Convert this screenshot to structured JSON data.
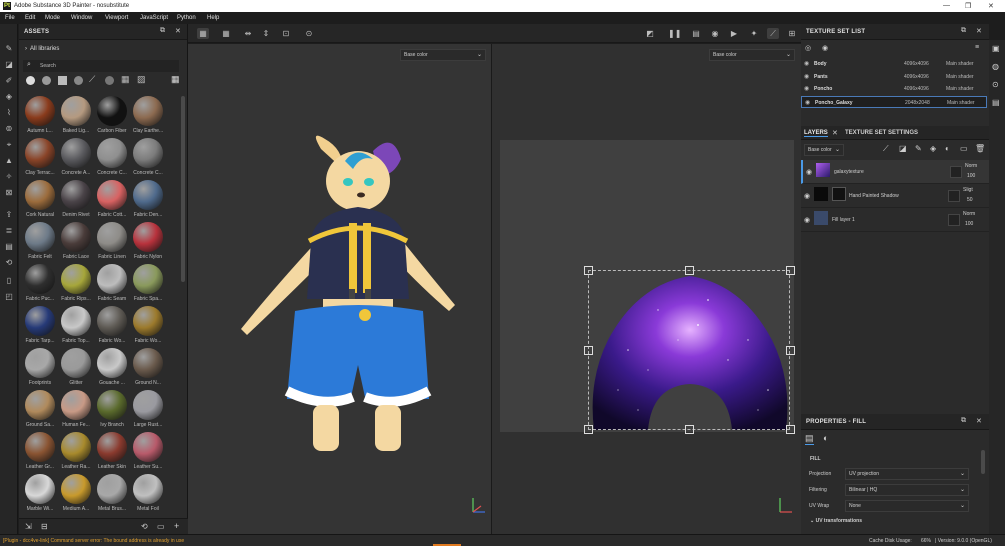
{
  "window": {
    "title": "Adobe Substance 3D Painter - nosubstitute",
    "minimize": "—",
    "restore": "❐",
    "close": "✕"
  },
  "menu": [
    "File",
    "Edit",
    "Mode",
    "Window",
    "Viewport",
    "JavaScript",
    "Python",
    "Help"
  ],
  "assets": {
    "title": "ASSETS",
    "all_libraries": "All libraries",
    "search_placeholder": "Search",
    "items": [
      {
        "label": "Autumn L...",
        "color": "#8a3b1c"
      },
      {
        "label": "Baked Lig...",
        "color": "#b59a80"
      },
      {
        "label": "Carbon Fiber",
        "color": "#111111"
      },
      {
        "label": "Clay Earthe...",
        "color": "#8c6a50"
      },
      {
        "label": "Clay Terrac...",
        "color": "#8a4428"
      },
      {
        "label": "Concrete A...",
        "color": "#5a5a5e"
      },
      {
        "label": "Concrete C...",
        "color": "#8f8f8f"
      },
      {
        "label": "Concrete C...",
        "color": "#7c7c7c"
      },
      {
        "label": "Cork Natural",
        "color": "#9c6c3c"
      },
      {
        "label": "Denim Rivet",
        "color": "#4a4348"
      },
      {
        "label": "Fabric Cott...",
        "color": "#d86262"
      },
      {
        "label": "Fabric Den...",
        "color": "#4f6a8c"
      },
      {
        "label": "Fabric Felt",
        "color": "#6d7a88"
      },
      {
        "label": "Fabric Lace",
        "color": "#4a3c3a"
      },
      {
        "label": "Fabric Linen",
        "color": "#8e8c88"
      },
      {
        "label": "Fabric Nylon",
        "color": "#b8323c"
      },
      {
        "label": "Fabric Puc...",
        "color": "#2e2e2e"
      },
      {
        "label": "Fabric Rips...",
        "color": "#a6a63a"
      },
      {
        "label": "Fabric Seam",
        "color": "#bdbdbd"
      },
      {
        "label": "Fabric Spa...",
        "color": "#8a9a5c"
      },
      {
        "label": "Fabric Tarp...",
        "color": "#263a78"
      },
      {
        "label": "Fabric Top...",
        "color": "#c8c8c8"
      },
      {
        "label": "Fabric Wo...",
        "color": "#5e5a54"
      },
      {
        "label": "Fabric Wo...",
        "color": "#9c7a2c"
      },
      {
        "label": "Footprints",
        "color": "#a8a8a8"
      },
      {
        "label": "Glitter",
        "color": "#9a9a9a"
      },
      {
        "label": "Gouache ...",
        "color": "#c9c9c9"
      },
      {
        "label": "Ground N...",
        "color": "#6a5a4c"
      },
      {
        "label": "Ground Sa...",
        "color": "#b08a5c"
      },
      {
        "label": "Human Fe...",
        "color": "#c89a86"
      },
      {
        "label": "Ivy Branch",
        "color": "#5a6a2c"
      },
      {
        "label": "Large Rust...",
        "color": "#9a9aa0"
      },
      {
        "label": "Leather Gr...",
        "color": "#8a5432"
      },
      {
        "label": "Leather Ra...",
        "color": "#a88a2c"
      },
      {
        "label": "Leather Skin",
        "color": "#8a3a2e"
      },
      {
        "label": "Leather Su...",
        "color": "#b85a6a"
      },
      {
        "label": "Marble Wi...",
        "color": "#d8d8d8"
      },
      {
        "label": "Medium A...",
        "color": "#c89a2c"
      },
      {
        "label": "Metal Brus...",
        "color": "#a8a8a8"
      },
      {
        "label": "Metal Foil",
        "color": "#c0c0c0"
      }
    ]
  },
  "viewport3d": {
    "channel": "Base color"
  },
  "viewport2d": {
    "channel": "Base color"
  },
  "texture_set_list": {
    "title": "TEXTURE SET LIST",
    "rows": [
      {
        "name": "Body",
        "res": "4096x4096",
        "shader": "Main shader"
      },
      {
        "name": "Pants",
        "res": "4096x4096",
        "shader": "Main shader"
      },
      {
        "name": "Poncho",
        "res": "4096x4096",
        "shader": "Main shader"
      },
      {
        "name": "Poncho_Galaxy",
        "res": "2048x2048",
        "shader": "Main shader"
      }
    ]
  },
  "layers": {
    "tab_layers": "LAYERS",
    "tab_settings": "TEXTURE SET SETTINGS",
    "channel": "Base color",
    "items": [
      {
        "name": "galaxytexture",
        "blend": "Norm",
        "opacity": "100"
      },
      {
        "name": "Hand Painted Shadow",
        "blend": "Sligt",
        "opacity": "50"
      },
      {
        "name": "Fill layer 1",
        "blend": "Norm",
        "opacity": "100"
      }
    ]
  },
  "properties": {
    "title": "PROPERTIES - FILL",
    "section": "FILL",
    "projection_label": "Projection",
    "projection": "UV projection",
    "filtering_label": "Filtering",
    "filtering": "Bilinear | HQ",
    "uvwrap_label": "UV Wrap",
    "uvwrap": "None",
    "uvtrans": "UV transformations"
  },
  "status": {
    "error": "[Plugin - dcc4ve-link] Command server error: The bound address is already in use",
    "cache": "Cache Disk Usage:",
    "cache_value": "66%",
    "version": "| Version: 9.0.0 (OpenGL)"
  }
}
